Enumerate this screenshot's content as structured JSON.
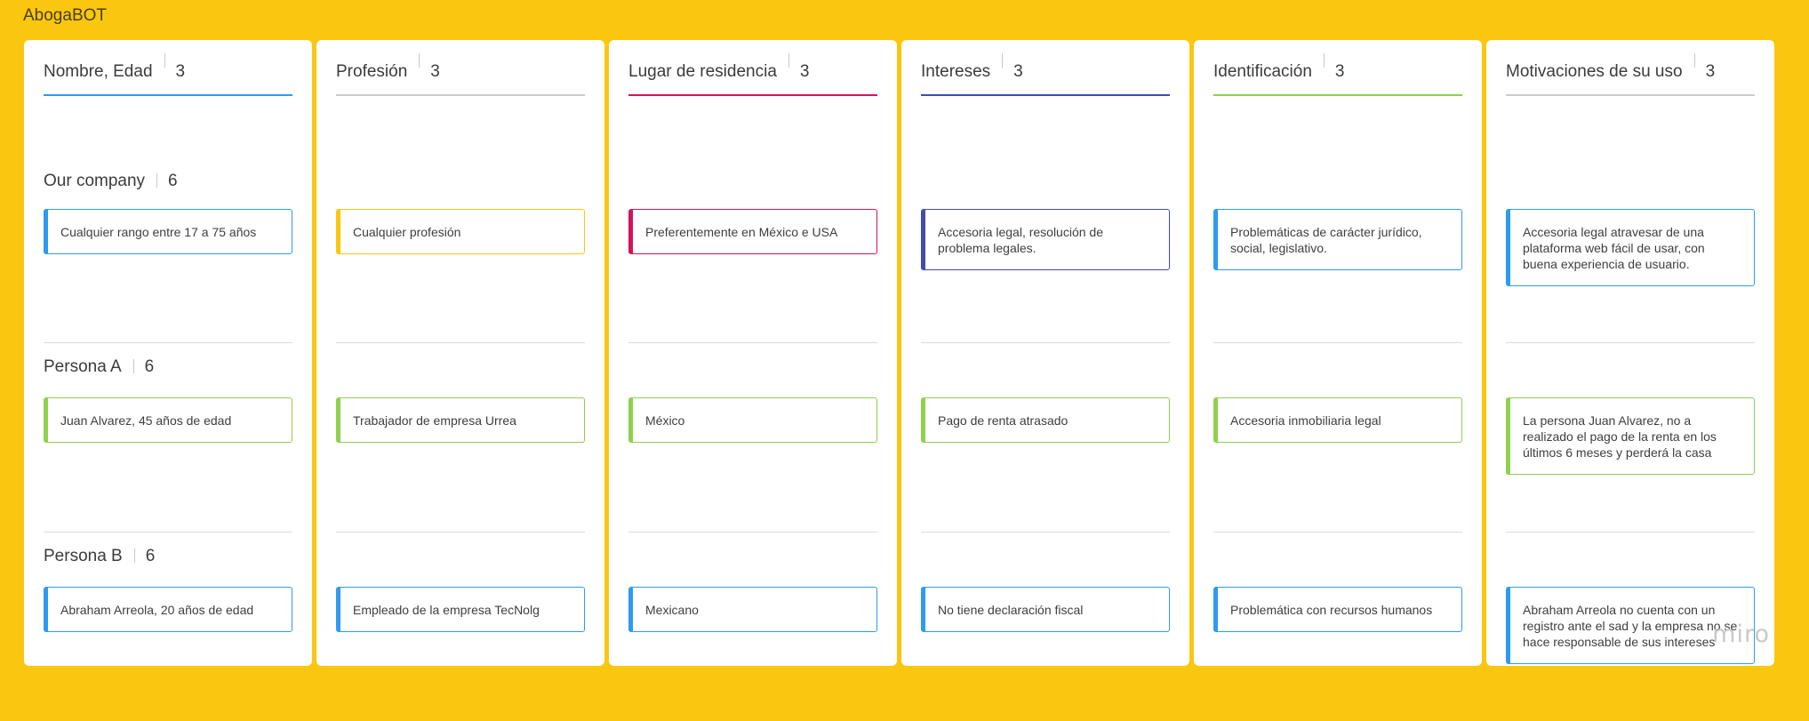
{
  "app": {
    "title": "AbogaBOT",
    "watermark": "miro"
  },
  "colors": {
    "background": "#FAC710",
    "blue": "#2D9BF0",
    "yellow": "#FAC710",
    "pink": "#D5135A",
    "indigo": "#414BB2",
    "green": "#8FD14F",
    "gray": "#CCCCCC"
  },
  "rows": [
    {
      "label": "Our company",
      "count": "6"
    },
    {
      "label": "Persona A",
      "count": "6"
    },
    {
      "label": "Persona B",
      "count": "6"
    }
  ],
  "columns": [
    {
      "title": "Nombre, Edad",
      "count": "3",
      "header_color": "blue",
      "cards": [
        {
          "text": "Cualquier rango entre 17 a 75 años",
          "color": "blue"
        },
        {
          "text": "Juan Alvarez, 45 años de edad",
          "color": "green"
        },
        {
          "text": "Abraham Arreola, 20 años de edad",
          "color": "blue"
        }
      ]
    },
    {
      "title": "Profesión",
      "count": "3",
      "header_color": "gray",
      "cards": [
        {
          "text": "Cualquier profesión",
          "color": "yellow"
        },
        {
          "text": "Trabajador de empresa Urrea",
          "color": "green"
        },
        {
          "text": "Empleado de la empresa TecNolg",
          "color": "blue"
        }
      ]
    },
    {
      "title": "Lugar de residencia",
      "count": "3",
      "header_color": "pink",
      "cards": [
        {
          "text": "Preferentemente en México e USA",
          "color": "pink"
        },
        {
          "text": "México",
          "color": "green"
        },
        {
          "text": "Mexicano",
          "color": "blue"
        }
      ]
    },
    {
      "title": "Intereses",
      "count": "3",
      "header_color": "indigo",
      "cards": [
        {
          "text": "Accesoria legal, resolución de problema legales.",
          "color": "indigo"
        },
        {
          "text": "Pago de renta atrasado",
          "color": "green"
        },
        {
          "text": "No tiene declaración fiscal",
          "color": "blue"
        }
      ]
    },
    {
      "title": "Identificación",
      "count": "3",
      "header_color": "green",
      "cards": [
        {
          "text": "Problemáticas de carácter jurídico, social, legislativo.",
          "color": "blue"
        },
        {
          "text": "Accesoria inmobiliaria legal",
          "color": "green"
        },
        {
          "text": "Problemática con recursos humanos",
          "color": "blue"
        }
      ]
    },
    {
      "title": "Motivaciones de su uso",
      "count": "3",
      "header_color": "gray",
      "cards": [
        {
          "text": "Accesoria legal atravesar de una plataforma web fácil de usar, con buena experiencia de usuario.",
          "color": "blue"
        },
        {
          "text": "La persona Juan Alvarez, no a realizado el pago de la renta en los últimos 6 meses y perderá la casa",
          "color": "green"
        },
        {
          "text": "Abraham Arreola no cuenta con un registro ante el sad y la empresa no se hace responsable de sus intereses",
          "color": "blue"
        }
      ]
    }
  ]
}
